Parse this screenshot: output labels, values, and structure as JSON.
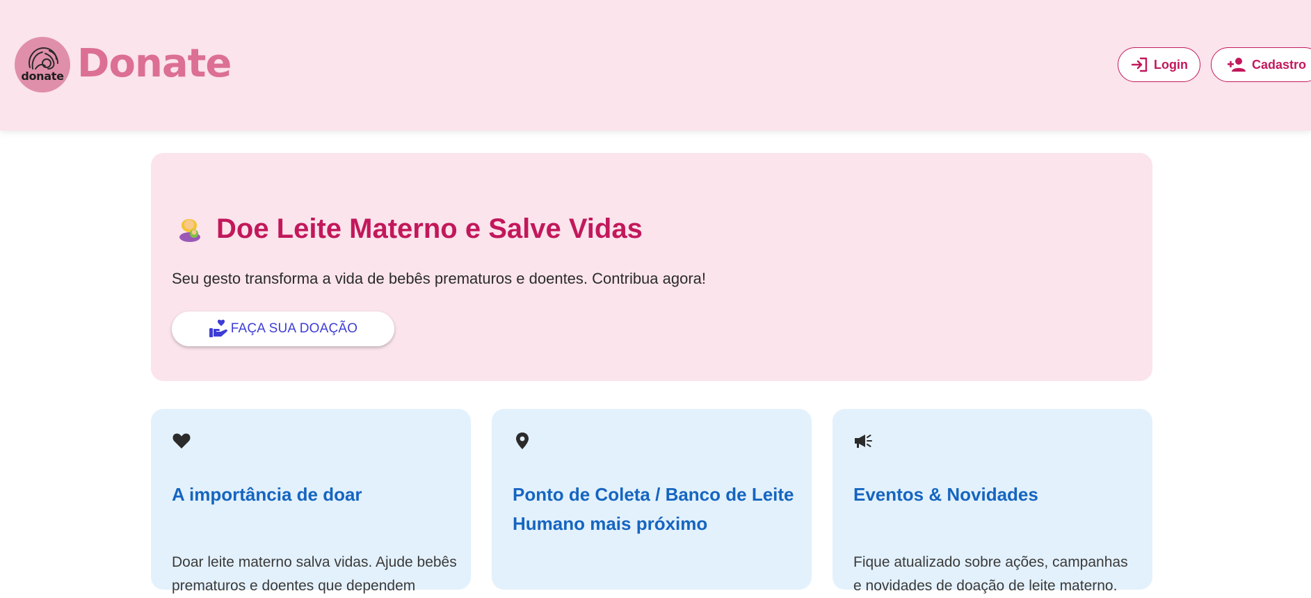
{
  "header": {
    "logo_text": "donate",
    "brand": "Donate",
    "login_label": "Login",
    "cadastro_label": "Cadastro",
    "colors": {
      "background": "#fbe4ec",
      "accent": "#c2185b",
      "brand": "#dc6f94"
    }
  },
  "hero": {
    "emoji_icon": "woman-feeding-baby-icon",
    "title": "Doe Leite Materno e Salve Vidas",
    "subtitle": "Seu gesto transforma a vida de bebês prematuros e doentes. Contribua agora!",
    "cta_label": "FAÇA SUA DOAÇÃO",
    "cta_icon": "hand-heart-icon"
  },
  "cards": [
    {
      "icon": "heart-icon",
      "title": "A importância de doar",
      "text": "Doar leite materno salva vidas. Ajude bebês prematuros e doentes que dependem"
    },
    {
      "icon": "location-pin-icon",
      "title": "Ponto de Coleta / Banco de Leite Humano mais próximo",
      "text": ""
    },
    {
      "icon": "megaphone-icon",
      "title": "Eventos & Novidades",
      "text": "Fique atualizado sobre ações, campanhas e novidades de doação de leite materno."
    }
  ]
}
